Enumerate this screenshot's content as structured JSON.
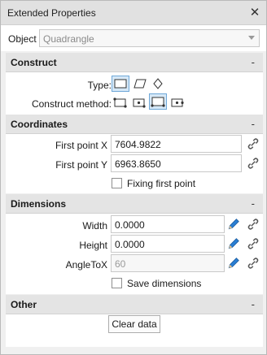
{
  "window": {
    "title": "Extended Properties",
    "close_icon": "close-icon"
  },
  "object": {
    "label": "Object",
    "value": "Quadrangle"
  },
  "construct": {
    "header": "Construct",
    "collapse": "-",
    "type_label": "Type:",
    "type_options": [
      "rectangle-icon",
      "parallelogram-icon",
      "rhombus-icon"
    ],
    "type_selected": 0,
    "method_label": "Construct method:",
    "method_options": [
      "method-corner-icon",
      "method-center-icon",
      "method-two-points-icon",
      "method-side-icon"
    ],
    "method_selected": 2
  },
  "coordinates": {
    "header": "Coordinates",
    "collapse": "-",
    "first_x_label": "First point X",
    "first_x_value": "7604.9822",
    "first_y_label": "First point Y",
    "first_y_value": "6963.8650",
    "fixing_label": "Fixing first point",
    "fixing_checked": false
  },
  "dimensions": {
    "header": "Dimensions",
    "collapse": "-",
    "width_label": "Width",
    "width_value": "0.0000",
    "height_label": "Height",
    "height_value": "0.0000",
    "angle_label": "AngleToX",
    "angle_value": "60",
    "save_label": "Save dimensions",
    "save_checked": false
  },
  "other": {
    "header": "Other",
    "collapse": "-"
  },
  "actions": {
    "clear_label": "Clear data"
  },
  "colors": {
    "selected_border": "#6fa8d8",
    "selected_fill": "#d6e8f7",
    "pencil_blue": "#2a7fd4"
  }
}
